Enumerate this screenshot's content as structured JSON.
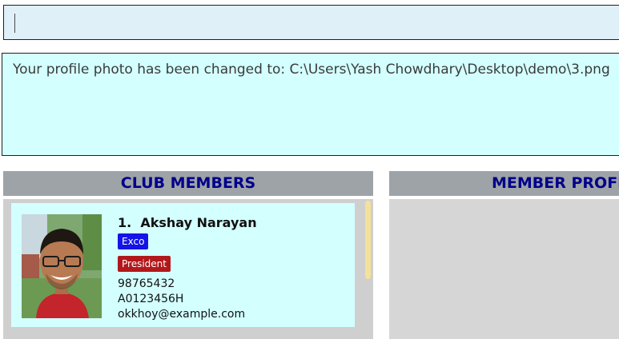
{
  "command_box": {
    "value": ""
  },
  "result_display": {
    "message": "Your profile photo has been changed to: C:\\Users\\Yash Chowdhary\\Desktop\\demo\\3.png"
  },
  "club_members_panel": {
    "title": "CLUB MEMBERS",
    "members": [
      {
        "index": "1.",
        "name": "Akshay Narayan",
        "tags": [
          "Exco",
          "President"
        ],
        "phone": "98765432",
        "matric": "A0123456H",
        "email": "okkhoy@example.com"
      }
    ]
  },
  "member_profile_panel": {
    "title": "MEMBER PROFILE"
  },
  "colors": {
    "header_text": "#00008b",
    "header_bg": "#9ea3a7",
    "card_bg": "#d3ffff",
    "tag_exco": "#1414e6",
    "tag_president": "#b2181b"
  }
}
